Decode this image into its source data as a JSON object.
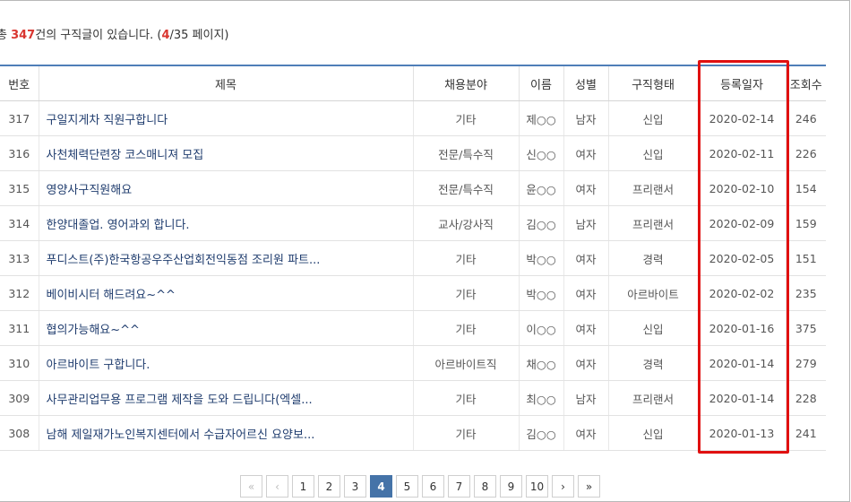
{
  "summary": {
    "prefix": "총 ",
    "count": "347",
    "middle": "건의 구직글이 있습니다. (",
    "current_page": "4",
    "total_pages": "/35 페이지)"
  },
  "table": {
    "headers": [
      "번호",
      "제목",
      "채용분야",
      "이름",
      "성별",
      "구직형태",
      "등록일자",
      "조회수"
    ],
    "rows": [
      {
        "no": "317",
        "title": "구일지게차 직원구합니다",
        "field": "기타",
        "name": "제○○",
        "gender": "남자",
        "type": "신입",
        "date": "2020-02-14",
        "views": "246"
      },
      {
        "no": "316",
        "title": "사천체력단련장 코스매니져 모집",
        "field": "전문/특수직",
        "name": "신○○",
        "gender": "여자",
        "type": "신입",
        "date": "2020-02-11",
        "views": "226"
      },
      {
        "no": "315",
        "title": "영양사구직원해요",
        "field": "전문/특수직",
        "name": "윤○○",
        "gender": "여자",
        "type": "프리랜서",
        "date": "2020-02-10",
        "views": "154"
      },
      {
        "no": "314",
        "title": "한양대졸업. 영어과외 합니다.",
        "field": "교사/강사직",
        "name": "김○○",
        "gender": "남자",
        "type": "프리랜서",
        "date": "2020-02-09",
        "views": "159"
      },
      {
        "no": "313",
        "title": "푸디스트(주)한국항공우주산업회전익동점 조리원 파트...",
        "field": "기타",
        "name": "박○○",
        "gender": "여자",
        "type": "경력",
        "date": "2020-02-05",
        "views": "151"
      },
      {
        "no": "312",
        "title": "베이비시터 해드려요~^^",
        "field": "기타",
        "name": "박○○",
        "gender": "여자",
        "type": "아르바이트",
        "date": "2020-02-02",
        "views": "235"
      },
      {
        "no": "311",
        "title": "협의가능해요~^^",
        "field": "기타",
        "name": "이○○",
        "gender": "여자",
        "type": "신입",
        "date": "2020-01-16",
        "views": "375"
      },
      {
        "no": "310",
        "title": "아르바이트 구합니다.",
        "field": "아르바이트직",
        "name": "채○○",
        "gender": "여자",
        "type": "경력",
        "date": "2020-01-14",
        "views": "279"
      },
      {
        "no": "309",
        "title": "사무관리업무용 프로그램 제작을 도와 드립니다(엑셀...",
        "field": "기타",
        "name": "최○○",
        "gender": "남자",
        "type": "프리랜서",
        "date": "2020-01-14",
        "views": "228"
      },
      {
        "no": "308",
        "title": "남해 제일재가노인복지센터에서 수급자어르신 요양보...",
        "field": "기타",
        "name": "김○○",
        "gender": "여자",
        "type": "신입",
        "date": "2020-01-13",
        "views": "241"
      }
    ]
  },
  "pagination": {
    "first": "«",
    "prev": "‹",
    "pages": [
      "1",
      "2",
      "3",
      "4",
      "5",
      "6",
      "7",
      "8",
      "9",
      "10"
    ],
    "active_index": 3,
    "next": "›",
    "last": "»"
  },
  "colors": {
    "accent": "#4f7fb8",
    "highlight": "#e01010",
    "count_red": "#d9352f",
    "active_page": "#4573a8"
  }
}
